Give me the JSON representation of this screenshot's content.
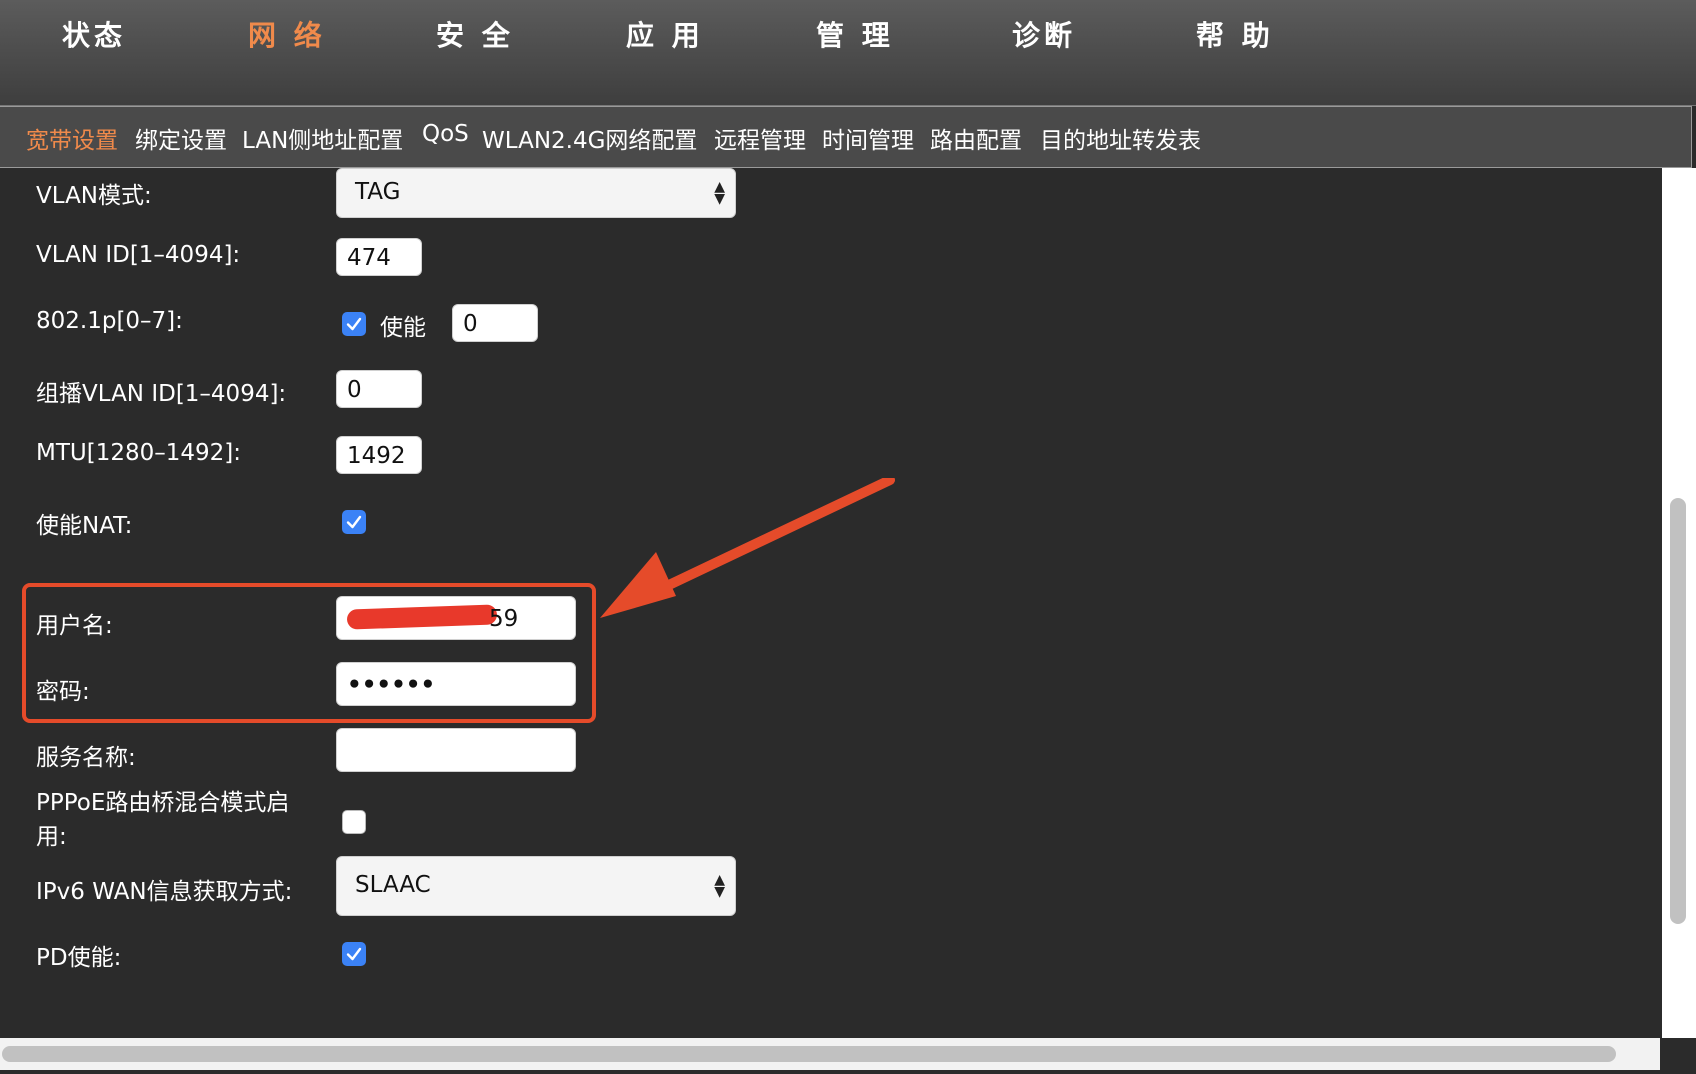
{
  "top_nav": {
    "items": [
      {
        "label": "状态"
      },
      {
        "label": "网 络"
      },
      {
        "label": "安 全"
      },
      {
        "label": "应 用"
      },
      {
        "label": "管 理"
      },
      {
        "label": "诊断"
      },
      {
        "label": "帮 助"
      }
    ],
    "active": "网 络"
  },
  "sub_nav": {
    "items": [
      {
        "label": "宽带设置"
      },
      {
        "label": "绑定设置"
      },
      {
        "label": "LAN侧地址配置"
      },
      {
        "label": "QoS"
      },
      {
        "label": "WLAN2.4G网络配置"
      },
      {
        "label": "远程管理"
      },
      {
        "label": "时间管理"
      },
      {
        "label": "路由配置"
      },
      {
        "label": "目的地址转发表"
      }
    ],
    "active": "宽带设置"
  },
  "form": {
    "vlan_mode": {
      "label": "VLAN模式:",
      "value": "TAG"
    },
    "vlan_id": {
      "label": "VLAN ID[1–4094]:",
      "value": "474"
    },
    "p8021": {
      "label": "802.1p[0–7]:",
      "enable_label": "使能",
      "enabled": true,
      "value": "0"
    },
    "multicast_vlan_id": {
      "label": "组播VLAN ID[1–4094]:",
      "value": "0"
    },
    "mtu": {
      "label": "MTU[1280–1492]:",
      "value": "1492"
    },
    "nat": {
      "label": "使能NAT:",
      "enabled": true
    },
    "username": {
      "label": "用户名:",
      "value_visible_suffix": "59"
    },
    "password": {
      "label": "密码:",
      "value": "••••••"
    },
    "service_name": {
      "label": "服务名称:",
      "value": ""
    },
    "pppoe_bridge": {
      "label": "PPPoE路由桥混合模式启用:",
      "enabled": false
    },
    "ipv6_wan": {
      "label": "IPv6 WAN信息获取方式:",
      "value": "SLAAC"
    },
    "pd_enable": {
      "label": "PD使能:",
      "enabled": true
    }
  },
  "colors": {
    "active_nav": "#f08a4b",
    "annotation": "#e54b2a",
    "checkbox": "#3b82f6",
    "background": "#2b2b2b"
  }
}
